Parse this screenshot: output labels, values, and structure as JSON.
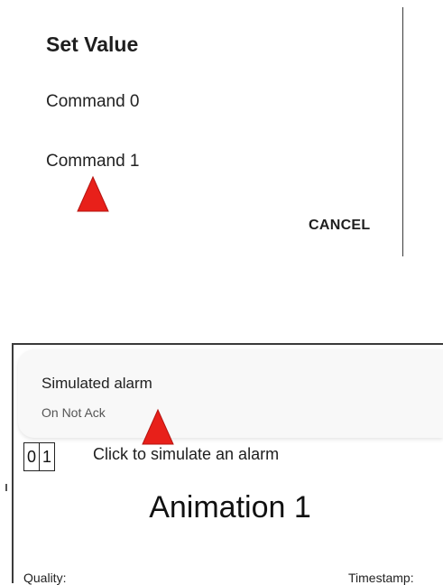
{
  "dialog": {
    "title": "Set Value",
    "options": [
      "Command 0",
      "Command 1"
    ],
    "cancel_label": "CANCEL"
  },
  "notification": {
    "title": "Simulated alarm",
    "body": "On Not Ack"
  },
  "app": {
    "digits": [
      "0",
      "1"
    ],
    "simulate_label": "Click to simulate an alarm",
    "animation_title": "Animation 1",
    "quality_label": "Quality:",
    "timestamp_label": "Timestamp:"
  },
  "colors": {
    "marker": "#e8201a",
    "notification_bg": "#f8f8f8"
  },
  "icons": [
    "red-pointer-marker",
    "red-pointer-marker"
  ]
}
